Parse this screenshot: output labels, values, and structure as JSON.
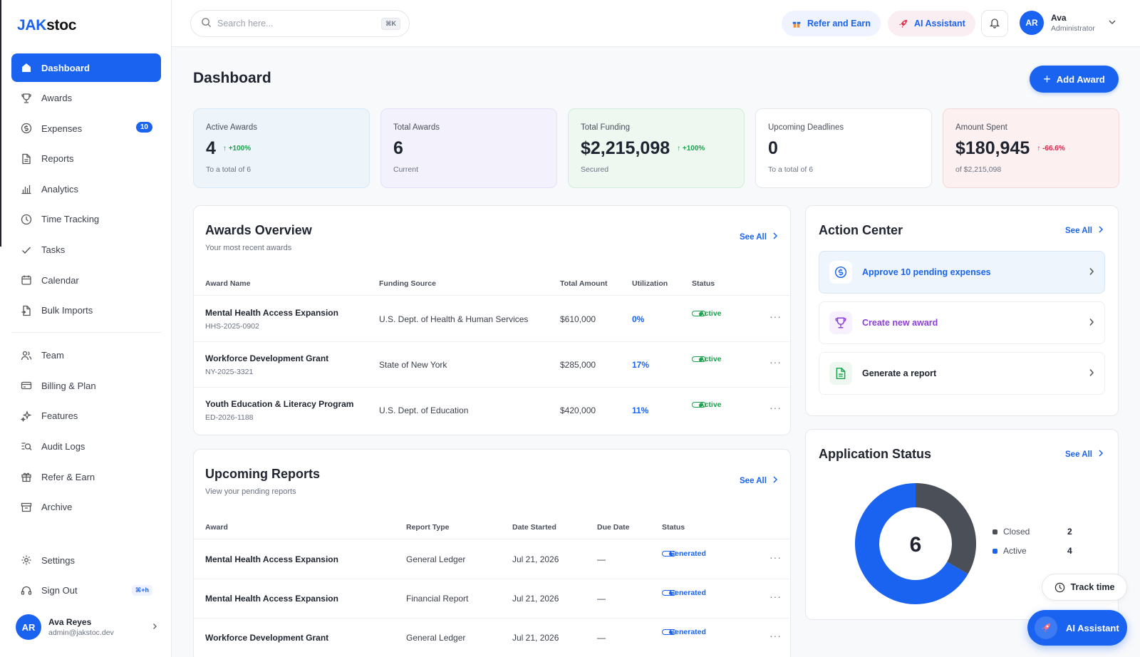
{
  "app": {
    "logo_brand": "JAK",
    "logo_rest": "stoc"
  },
  "sidebar": {
    "items": [
      {
        "label": "Dashboard",
        "icon": "home-icon"
      },
      {
        "label": "Awards",
        "icon": "trophy-icon"
      },
      {
        "label": "Expenses",
        "icon": "dollar-icon",
        "badge": "10"
      },
      {
        "label": "Reports",
        "icon": "document-icon"
      },
      {
        "label": "Analytics",
        "icon": "bar-chart-icon"
      },
      {
        "label": "Time Tracking",
        "icon": "clock-icon"
      },
      {
        "label": "Tasks",
        "icon": "check-icon"
      },
      {
        "label": "Calendar",
        "icon": "calendar-icon"
      },
      {
        "label": "Bulk Imports",
        "icon": "file-import-icon"
      }
    ],
    "items2": [
      {
        "label": "Team",
        "icon": "users-icon"
      },
      {
        "label": "Billing & Plan",
        "icon": "credit-card-icon"
      },
      {
        "label": "Features",
        "icon": "sparkle-icon"
      },
      {
        "label": "Audit Logs",
        "icon": "audit-search-icon"
      },
      {
        "label": "Refer & Earn",
        "icon": "gift-icon"
      },
      {
        "label": "Archive",
        "icon": "archive-icon"
      }
    ],
    "settings": "Settings",
    "signout": "Sign Out",
    "signout_kbd": "⌘+h",
    "profile": {
      "initials": "AR",
      "name": "Ava Reyes",
      "email": "admin@jakstoc.dev"
    }
  },
  "topbar": {
    "search_placeholder": "Search here...",
    "search_kbd": "⌘K",
    "refer": "Refer and Earn",
    "ai": "AI Assistant",
    "user": {
      "initials": "AR",
      "name": "Ava",
      "role": "Administrator"
    }
  },
  "page": {
    "title": "Dashboard",
    "add_award": "Add Award"
  },
  "stats": [
    {
      "label": "Active Awards",
      "value": "4",
      "delta": "+100%",
      "sub": "To a total of 6"
    },
    {
      "label": "Total Awards",
      "value": "6",
      "delta": "",
      "sub": "Current"
    },
    {
      "label": "Total Funding",
      "value": "$2,215,098",
      "delta": "+100%",
      "sub": "Secured"
    },
    {
      "label": "Upcoming Deadlines",
      "value": "0",
      "delta": "",
      "sub": "To a total of 6"
    },
    {
      "label": "Amount Spent",
      "value": "$180,945",
      "delta": "-66.6%",
      "sub": "of $2,215,098"
    }
  ],
  "awards": {
    "title": "Awards Overview",
    "subtitle": "Your most recent awards",
    "see_all": "See All",
    "headers": [
      "Award Name",
      "Funding Source",
      "Total Amount",
      "Utilization",
      "Status"
    ],
    "rows": [
      {
        "name": "Mental Health Access Expansion",
        "code": "HHS-2025-0902",
        "source": "U.S. Dept. of Health & Human Services",
        "amount": "$610,000",
        "util": "0%",
        "status": "Active"
      },
      {
        "name": "Workforce Development Grant",
        "code": "NY-2025-3321",
        "source": "State of New York",
        "amount": "$285,000",
        "util": "17%",
        "status": "Active"
      },
      {
        "name": "Youth Education & Literacy Program",
        "code": "ED-2026-1188",
        "source": "U.S. Dept. of Education",
        "amount": "$420,000",
        "util": "11%",
        "status": "Active"
      }
    ]
  },
  "reports": {
    "title": "Upcoming Reports",
    "subtitle": "View your pending reports",
    "see_all": "See All",
    "headers": [
      "Award",
      "Report Type",
      "Date Started",
      "Due Date",
      "Status"
    ],
    "rows": [
      {
        "award": "Mental Health Access Expansion",
        "type": "General Ledger",
        "started": "Jul 21, 2026",
        "due": "—",
        "status": "Generated"
      },
      {
        "award": "Mental Health Access Expansion",
        "type": "Financial Report",
        "started": "Jul 21, 2026",
        "due": "—",
        "status": "Generated"
      },
      {
        "award": "Workforce Development Grant",
        "type": "General Ledger",
        "started": "Jul 21, 2026",
        "due": "—",
        "status": "Generated"
      }
    ]
  },
  "action_center": {
    "title": "Action Center",
    "see_all": "See All",
    "items": [
      {
        "label": "Approve 10 pending expenses",
        "icon": "dollar-icon"
      },
      {
        "label": "Create new award",
        "icon": "trophy-icon"
      },
      {
        "label": "Generate a report",
        "icon": "document-icon"
      }
    ]
  },
  "app_status": {
    "title": "Application Status",
    "see_all": "See All",
    "total": "6",
    "legend": [
      {
        "label": "Closed",
        "count": "2",
        "color": "#4b5058"
      },
      {
        "label": "Active",
        "count": "4",
        "color": "#1a63f0"
      }
    ]
  },
  "chart_data": {
    "type": "pie",
    "categories": [
      "Closed",
      "Active"
    ],
    "values": [
      2,
      4
    ]
  },
  "floating": {
    "track": "Track time",
    "ai": "AI Assistant"
  },
  "colors": {
    "primary": "#1a63f0",
    "success": "#16a34a",
    "danger": "#e11d48"
  }
}
